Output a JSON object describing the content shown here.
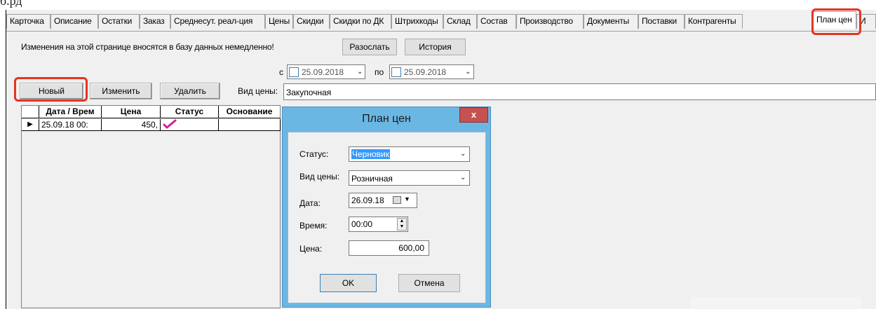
{
  "header_snippet": "б.рд",
  "tabs": [
    {
      "label": "Карточка"
    },
    {
      "label": "Описание"
    },
    {
      "label": "Остатки"
    },
    {
      "label": "Заказ"
    },
    {
      "label": "Среднесут. реал-ция"
    },
    {
      "label": "Цены"
    },
    {
      "label": "Скидки"
    },
    {
      "label": "Скидки по ДК"
    },
    {
      "label": "Штрихкоды"
    },
    {
      "label": "Склад"
    },
    {
      "label": "Состав"
    },
    {
      "label": "Производство"
    },
    {
      "label": "Документы"
    },
    {
      "label": "Поставки"
    },
    {
      "label": "Контрагенты"
    },
    {
      "label": "План цен"
    },
    {
      "label": "И"
    }
  ],
  "info_text": "Изменения на этой странице вносятся в базу данных немедленно!",
  "toolbar": {
    "send_label": "Разослать",
    "history_label": "История",
    "new_label": "Новый",
    "edit_label": "Изменить",
    "delete_label": "Удалить"
  },
  "date_filter": {
    "from_label": "с",
    "from_value": "25.09.2018",
    "to_label": "по",
    "to_value": "25.09.2018"
  },
  "price_type": {
    "label": "Вид цены:",
    "value": "Закупочная"
  },
  "grid": {
    "columns": [
      "Дата / Врем",
      "Цена",
      "Статус",
      "Основание"
    ],
    "rows": [
      {
        "date": "25.09.18 00:",
        "price": "450,",
        "status_icon": "checkmark-icon",
        "reason": ""
      }
    ]
  },
  "dialog": {
    "title": "План цен",
    "close_label": "x",
    "status_label": "Статус:",
    "status_value": "Черновик",
    "price_type_label": "Вид цены:",
    "price_type_value": "Розничная",
    "date_label": "Дата:",
    "date_value": "26.09.18",
    "time_label": "Время:",
    "time_value": "00:00",
    "price_label": "Цена:",
    "price_value": "600,00",
    "ok_label": "OK",
    "cancel_label": "Отмена"
  },
  "colors": {
    "highlight_red": "#e53424",
    "dialog_frame": "#6bb7e4",
    "selection": "#3399ff",
    "checkmark": "#d81b9a"
  }
}
